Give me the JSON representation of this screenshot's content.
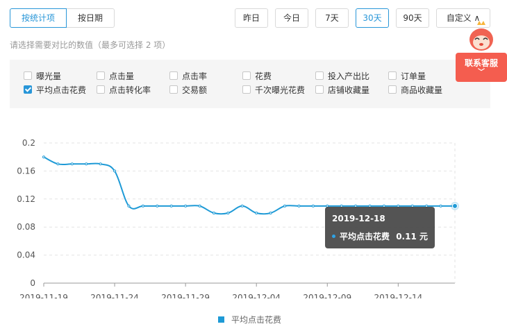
{
  "toggle": {
    "by_metric": "按统计项",
    "by_date": "按日期"
  },
  "ranges": [
    {
      "label": "昨日",
      "active": false
    },
    {
      "label": "今日",
      "active": false
    },
    {
      "label": "7天",
      "active": false
    },
    {
      "label": "30天",
      "active": true
    },
    {
      "label": "90天",
      "active": false
    },
    {
      "label": "自定义 ∧",
      "active": false
    }
  ],
  "hint": "请选择需要对比的数值（最多可选择 2 项）",
  "metrics": [
    {
      "label": "曝光量",
      "checked": false
    },
    {
      "label": "点击量",
      "checked": false
    },
    {
      "label": "点击率",
      "checked": false
    },
    {
      "label": "花费",
      "checked": false
    },
    {
      "label": "投入产出比",
      "checked": false
    },
    {
      "label": "订单量",
      "checked": false
    },
    {
      "label": "平均点击花费",
      "checked": true
    },
    {
      "label": "点击转化率",
      "checked": false
    },
    {
      "label": "交易额",
      "checked": false
    },
    {
      "label": "千次曝光花费",
      "checked": false
    },
    {
      "label": "店铺收藏量",
      "checked": false
    },
    {
      "label": "商品收藏量",
      "checked": false
    }
  ],
  "service": {
    "label": "联系客服",
    "chevron": "﹀",
    "icon": "mascot-icon"
  },
  "colors": {
    "accent": "#2896d8",
    "line": "#1e9ad6",
    "service": "#f45d4f"
  },
  "tooltip": {
    "date": "2019-12-18",
    "series": "平均点击花费",
    "value": "0.11 元"
  },
  "chart_data": {
    "type": "line",
    "x": [
      "2019-11-19",
      "2019-11-20",
      "2019-11-21",
      "2019-11-22",
      "2019-11-23",
      "2019-11-24",
      "2019-11-25",
      "2019-11-26",
      "2019-11-27",
      "2019-11-28",
      "2019-11-29",
      "2019-11-30",
      "2019-12-01",
      "2019-12-02",
      "2019-12-03",
      "2019-12-04",
      "2019-12-05",
      "2019-12-06",
      "2019-12-07",
      "2019-12-08",
      "2019-12-09",
      "2019-12-10",
      "2019-12-11",
      "2019-12-12",
      "2019-12-13",
      "2019-12-14",
      "2019-12-15",
      "2019-12-16",
      "2019-12-17",
      "2019-12-18"
    ],
    "series": [
      {
        "name": "平均点击花费",
        "values": [
          0.18,
          0.17,
          0.17,
          0.17,
          0.17,
          0.16,
          0.11,
          0.11,
          0.11,
          0.11,
          0.11,
          0.11,
          0.1,
          0.1,
          0.11,
          0.1,
          0.1,
          0.11,
          0.11,
          0.11,
          0.11,
          0.11,
          0.11,
          0.11,
          0.11,
          0.11,
          0.11,
          0.11,
          0.11,
          0.11
        ]
      }
    ],
    "xticks": [
      "2019-11-19",
      "2019-11-24",
      "2019-11-29",
      "2019-12-04",
      "2019-12-09",
      "2019-12-14"
    ],
    "yticks": [
      "0",
      "0.04",
      "0.08",
      "0.12",
      "0.16",
      "0.2"
    ],
    "ylim": [
      0,
      0.2
    ],
    "grid": true,
    "legend": "bottom-center",
    "highlight_index": 29
  }
}
